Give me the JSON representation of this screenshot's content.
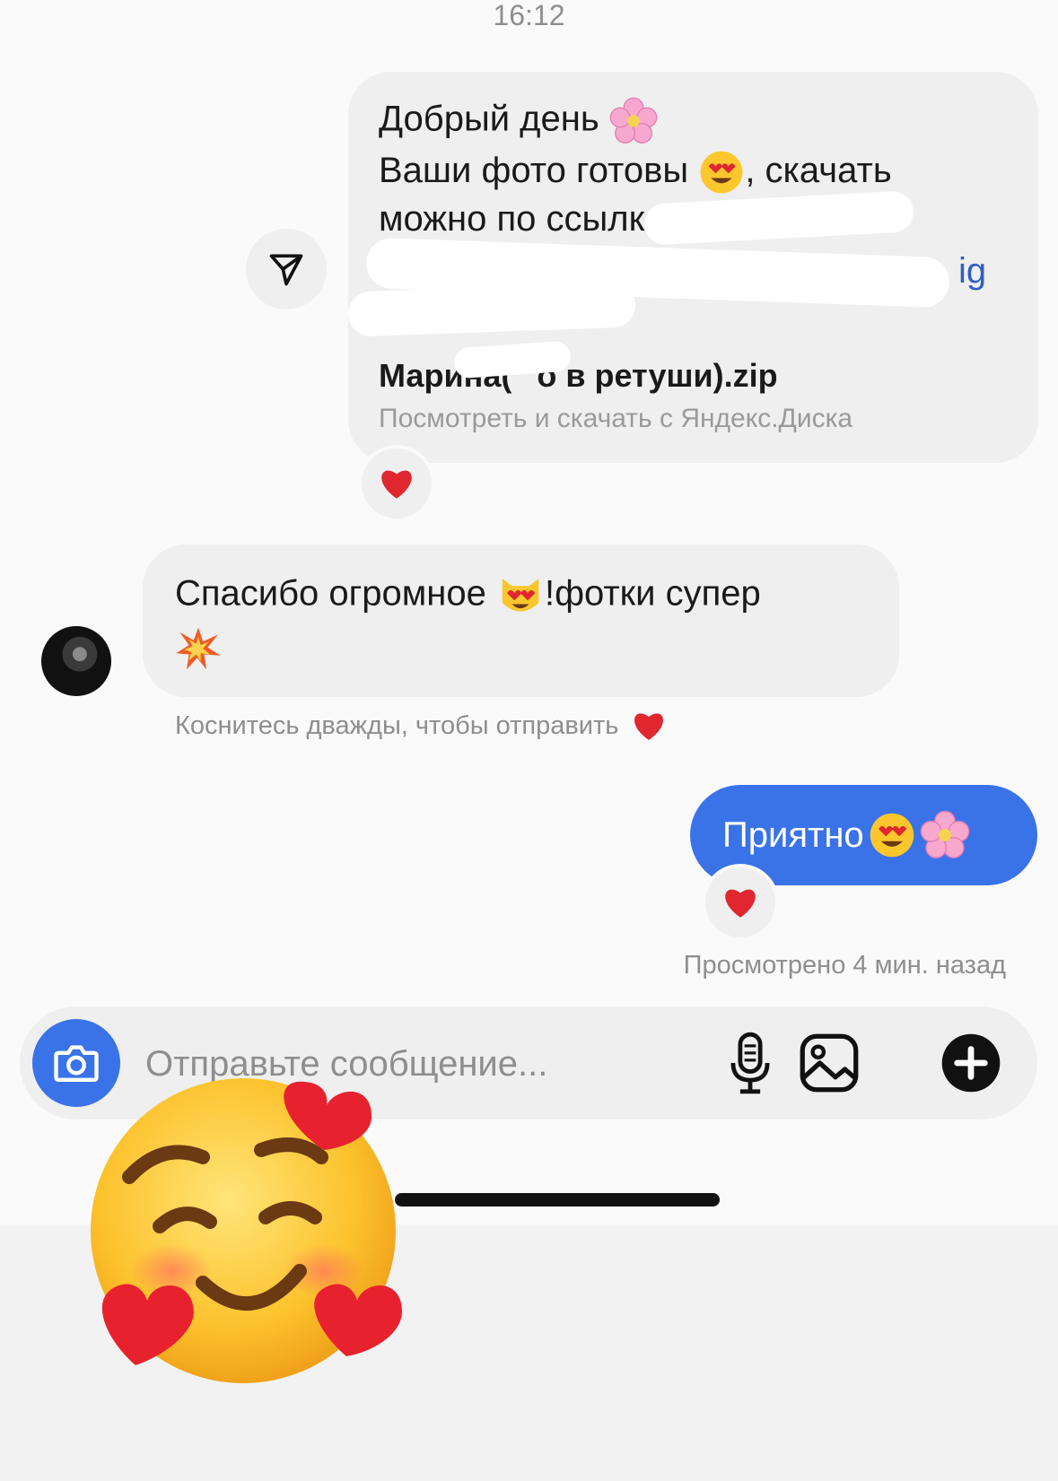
{
  "header": {
    "time": "16:12"
  },
  "messages": {
    "first": {
      "line1": "Добрый день",
      "line2a": "Ваши фото готовы",
      "line2b": ", скачать",
      "line3": "можно по ссылке",
      "link_fragment": "ig",
      "file_name": "Марина(",
      "file_name_tail": "о в ретуши).zip",
      "file_source": "Посмотреть и скачать с Яндекс.Диска"
    },
    "incoming": {
      "text": "Спасибо огромное",
      "text_tail": "!фотки супер"
    },
    "hint": "Коснитесь дважды, чтобы отправить",
    "reply": {
      "text": "Приятно"
    },
    "seen": "Просмотрено 4 мин. назад"
  },
  "composer": {
    "placeholder": "Отправьте сообщение..."
  },
  "icons": {
    "share": "send-icon",
    "camera": "camera-icon",
    "mic": "microphone-icon",
    "gallery": "gallery-icon",
    "plus": "plus-icon",
    "heart": "heart-icon",
    "sticker": "smiling-face-with-hearts"
  },
  "colors": {
    "accent": "#3a73e8",
    "bubble_grey": "#efefef",
    "heart": "#e0262f"
  }
}
